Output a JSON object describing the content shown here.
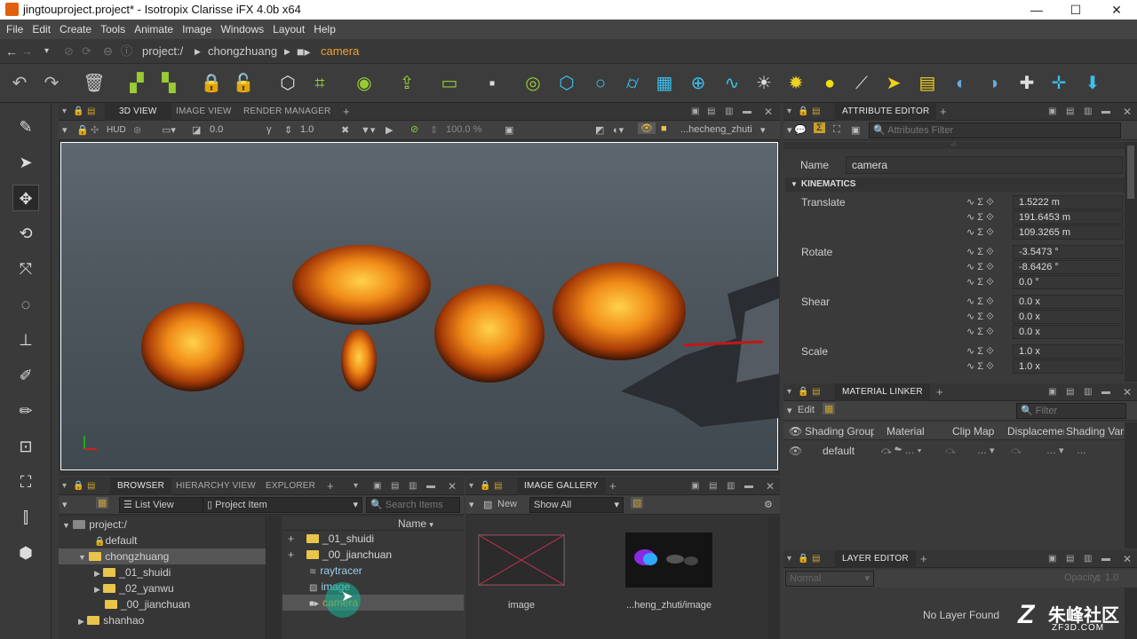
{
  "window": {
    "title": "jingtouproject.project* - Isotropix Clarisse iFX 4.0b x64",
    "minimize": "—",
    "maximize": "☐",
    "close": "✕"
  },
  "menu": [
    "File",
    "Edit",
    "Create",
    "Tools",
    "Animate",
    "Image",
    "Windows",
    "Layout",
    "Help"
  ],
  "nav": {
    "crumbs": [
      "project:/",
      "chongzhuang",
      "camera"
    ]
  },
  "viewport": {
    "tabs": [
      "3D VIEW",
      "IMAGE VIEW",
      "RENDER MANAGER"
    ],
    "hud": "HUD",
    "val1": "0.0",
    "val2": "1.0",
    "zoom": "100.0 %",
    "path": "...hecheng_zhuti"
  },
  "browser": {
    "tabs": [
      "BROWSER",
      "HIERARCHY VIEW",
      "EXPLORER"
    ],
    "view_mode": "List View",
    "item_type": "Project Item",
    "search_placeholder": "Search Items",
    "col_name": "Name",
    "tree": [
      {
        "label": "project:/",
        "depth": 0,
        "expander": "▼",
        "lock": false,
        "folder": true
      },
      {
        "label": "default",
        "depth": 1,
        "expander": "",
        "lock": true,
        "folder": false
      },
      {
        "label": "chongzhuang",
        "depth": 1,
        "expander": "▼",
        "lock": false,
        "folder": true,
        "selected": true
      },
      {
        "label": "_01_shuidi",
        "depth": 2,
        "expander": "▶",
        "lock": false,
        "folder": true
      },
      {
        "label": "_02_yanwu",
        "depth": 2,
        "expander": "▶",
        "lock": false,
        "folder": true
      },
      {
        "label": "_00_jianchuan",
        "depth": 2,
        "expander": "",
        "lock": false,
        "folder": true
      },
      {
        "label": "shanhao",
        "depth": 1,
        "expander": "▶",
        "lock": false,
        "folder": true
      }
    ],
    "items": [
      {
        "label": "_01_shuidi",
        "kind": "folder"
      },
      {
        "label": "_00_jianchuan",
        "kind": "folder"
      },
      {
        "label": "raytracer",
        "kind": "raytracer"
      },
      {
        "label": "image",
        "kind": "image"
      },
      {
        "label": "camera",
        "kind": "camera"
      }
    ]
  },
  "gallery": {
    "title": "IMAGE GALLERY",
    "new": "New",
    "filter": "Show All",
    "thumbs": [
      {
        "label": "image"
      },
      {
        "label": "...heng_zhuti/image"
      }
    ]
  },
  "attr": {
    "title": "ATTRIBUTE EDITOR",
    "filter_placeholder": "Attributes Filter",
    "name_label": "Name",
    "name_value": "camera",
    "section": "KINEMATICS",
    "groups": [
      {
        "label": "Translate",
        "values": [
          "1.5222 m",
          "191.6453 m",
          "109.3265 m"
        ]
      },
      {
        "label": "Rotate",
        "values": [
          "-3.5473 °",
          "-8.6426 °",
          "0.0 °"
        ]
      },
      {
        "label": "Shear",
        "values": [
          "0.0 x",
          "0.0 x",
          "0.0 x"
        ]
      },
      {
        "label": "Scale",
        "values": [
          "1.0 x",
          "1.0 x"
        ]
      }
    ]
  },
  "matlinker": {
    "title": "MATERIAL LINKER",
    "edit": "Edit",
    "filter_placeholder": "Filter",
    "cols": [
      "Shading Group",
      "Material",
      "Clip Map",
      "Displacement",
      "Shading Variable"
    ],
    "row": {
      "group": "default"
    }
  },
  "layer": {
    "title": "LAYER EDITOR",
    "blend": "Normal",
    "opacity_label": "Opacity",
    "opacity": "1.0",
    "empty": "No Layer Found"
  },
  "watermark": {
    "brand": "朱峰社区",
    "url": "ZF3D.COM"
  }
}
